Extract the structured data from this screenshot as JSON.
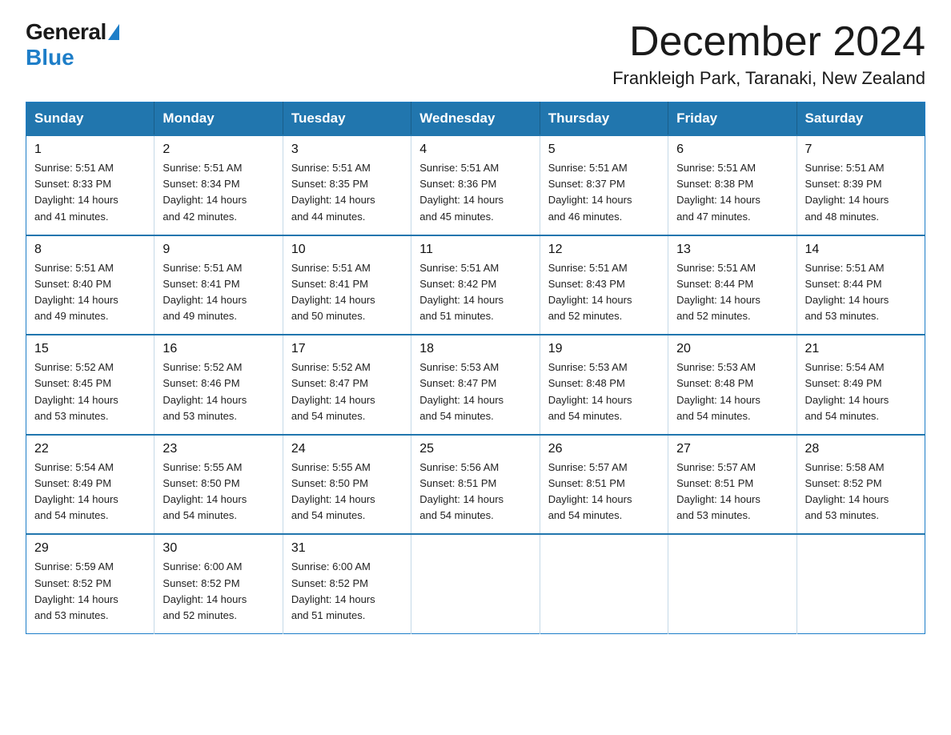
{
  "logo": {
    "general": "General",
    "blue": "Blue"
  },
  "title": "December 2024",
  "subtitle": "Frankleigh Park, Taranaki, New Zealand",
  "days_of_week": [
    "Sunday",
    "Monday",
    "Tuesday",
    "Wednesday",
    "Thursday",
    "Friday",
    "Saturday"
  ],
  "weeks": [
    [
      {
        "day": "1",
        "sunrise": "5:51 AM",
        "sunset": "8:33 PM",
        "daylight": "14 hours and 41 minutes."
      },
      {
        "day": "2",
        "sunrise": "5:51 AM",
        "sunset": "8:34 PM",
        "daylight": "14 hours and 42 minutes."
      },
      {
        "day": "3",
        "sunrise": "5:51 AM",
        "sunset": "8:35 PM",
        "daylight": "14 hours and 44 minutes."
      },
      {
        "day": "4",
        "sunrise": "5:51 AM",
        "sunset": "8:36 PM",
        "daylight": "14 hours and 45 minutes."
      },
      {
        "day": "5",
        "sunrise": "5:51 AM",
        "sunset": "8:37 PM",
        "daylight": "14 hours and 46 minutes."
      },
      {
        "day": "6",
        "sunrise": "5:51 AM",
        "sunset": "8:38 PM",
        "daylight": "14 hours and 47 minutes."
      },
      {
        "day": "7",
        "sunrise": "5:51 AM",
        "sunset": "8:39 PM",
        "daylight": "14 hours and 48 minutes."
      }
    ],
    [
      {
        "day": "8",
        "sunrise": "5:51 AM",
        "sunset": "8:40 PM",
        "daylight": "14 hours and 49 minutes."
      },
      {
        "day": "9",
        "sunrise": "5:51 AM",
        "sunset": "8:41 PM",
        "daylight": "14 hours and 49 minutes."
      },
      {
        "day": "10",
        "sunrise": "5:51 AM",
        "sunset": "8:41 PM",
        "daylight": "14 hours and 50 minutes."
      },
      {
        "day": "11",
        "sunrise": "5:51 AM",
        "sunset": "8:42 PM",
        "daylight": "14 hours and 51 minutes."
      },
      {
        "day": "12",
        "sunrise": "5:51 AM",
        "sunset": "8:43 PM",
        "daylight": "14 hours and 52 minutes."
      },
      {
        "day": "13",
        "sunrise": "5:51 AM",
        "sunset": "8:44 PM",
        "daylight": "14 hours and 52 minutes."
      },
      {
        "day": "14",
        "sunrise": "5:51 AM",
        "sunset": "8:44 PM",
        "daylight": "14 hours and 53 minutes."
      }
    ],
    [
      {
        "day": "15",
        "sunrise": "5:52 AM",
        "sunset": "8:45 PM",
        "daylight": "14 hours and 53 minutes."
      },
      {
        "day": "16",
        "sunrise": "5:52 AM",
        "sunset": "8:46 PM",
        "daylight": "14 hours and 53 minutes."
      },
      {
        "day": "17",
        "sunrise": "5:52 AM",
        "sunset": "8:47 PM",
        "daylight": "14 hours and 54 minutes."
      },
      {
        "day": "18",
        "sunrise": "5:53 AM",
        "sunset": "8:47 PM",
        "daylight": "14 hours and 54 minutes."
      },
      {
        "day": "19",
        "sunrise": "5:53 AM",
        "sunset": "8:48 PM",
        "daylight": "14 hours and 54 minutes."
      },
      {
        "day": "20",
        "sunrise": "5:53 AM",
        "sunset": "8:48 PM",
        "daylight": "14 hours and 54 minutes."
      },
      {
        "day": "21",
        "sunrise": "5:54 AM",
        "sunset": "8:49 PM",
        "daylight": "14 hours and 54 minutes."
      }
    ],
    [
      {
        "day": "22",
        "sunrise": "5:54 AM",
        "sunset": "8:49 PM",
        "daylight": "14 hours and 54 minutes."
      },
      {
        "day": "23",
        "sunrise": "5:55 AM",
        "sunset": "8:50 PM",
        "daylight": "14 hours and 54 minutes."
      },
      {
        "day": "24",
        "sunrise": "5:55 AM",
        "sunset": "8:50 PM",
        "daylight": "14 hours and 54 minutes."
      },
      {
        "day": "25",
        "sunrise": "5:56 AM",
        "sunset": "8:51 PM",
        "daylight": "14 hours and 54 minutes."
      },
      {
        "day": "26",
        "sunrise": "5:57 AM",
        "sunset": "8:51 PM",
        "daylight": "14 hours and 54 minutes."
      },
      {
        "day": "27",
        "sunrise": "5:57 AM",
        "sunset": "8:51 PM",
        "daylight": "14 hours and 53 minutes."
      },
      {
        "day": "28",
        "sunrise": "5:58 AM",
        "sunset": "8:52 PM",
        "daylight": "14 hours and 53 minutes."
      }
    ],
    [
      {
        "day": "29",
        "sunrise": "5:59 AM",
        "sunset": "8:52 PM",
        "daylight": "14 hours and 53 minutes."
      },
      {
        "day": "30",
        "sunrise": "6:00 AM",
        "sunset": "8:52 PM",
        "daylight": "14 hours and 52 minutes."
      },
      {
        "day": "31",
        "sunrise": "6:00 AM",
        "sunset": "8:52 PM",
        "daylight": "14 hours and 51 minutes."
      },
      null,
      null,
      null,
      null
    ]
  ],
  "labels": {
    "sunrise": "Sunrise:",
    "sunset": "Sunset:",
    "daylight": "Daylight:"
  }
}
